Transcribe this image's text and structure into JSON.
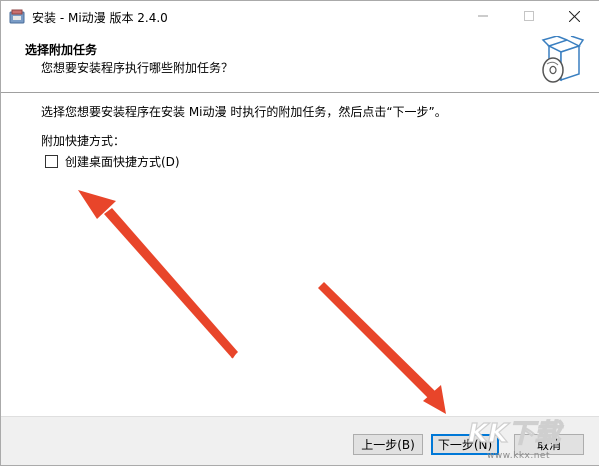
{
  "window": {
    "title": "安装 - Mi动漫 版本 2.4.0",
    "icon": "installer-icon"
  },
  "header": {
    "title": "选择附加任务",
    "subtitle": "您想要安装程序执行哪些附加任务？",
    "icon": "setup-box-cd-icon"
  },
  "body": {
    "instruction": "选择您想要安装程序在安装 Mi动漫 时执行的附加任务，然后点击“下一步”。",
    "group_label": "附加快捷方式：",
    "tasks": [
      {
        "label": "创建桌面快捷方式(D)",
        "checked": false
      }
    ]
  },
  "footer": {
    "back_label": "上一步(B)",
    "next_label": "下一步(N)",
    "cancel_label": "取消"
  },
  "watermark": {
    "text": "KK下载",
    "url_text": "www.kkx.net"
  },
  "colors": {
    "arrow": "#e8452a",
    "focus_border": "#0078d7",
    "footer_bg": "#f0f0f0"
  }
}
